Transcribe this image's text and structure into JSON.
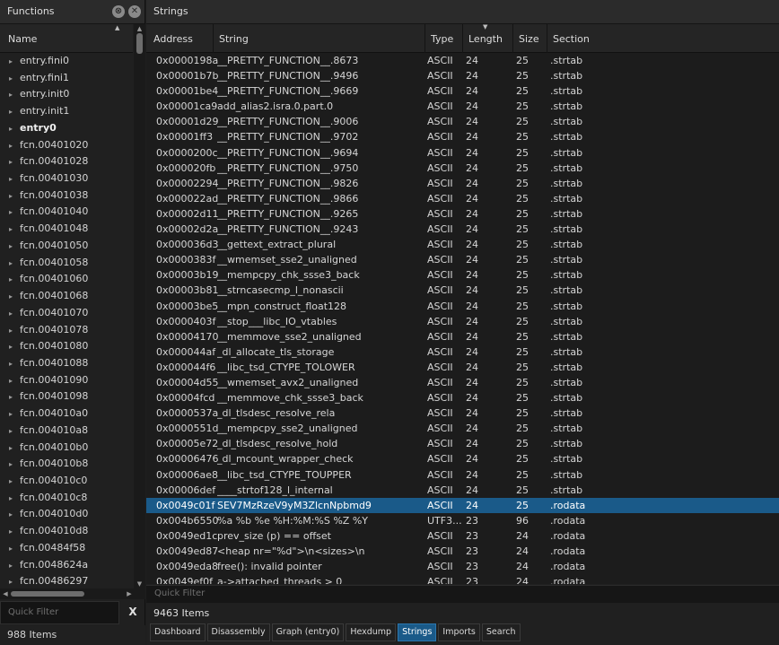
{
  "functions_pane": {
    "title": "Functions",
    "column_header": "Name",
    "items": [
      {
        "name": "entry.fini0",
        "bold": false
      },
      {
        "name": "entry.fini1",
        "bold": false
      },
      {
        "name": "entry.init0",
        "bold": false
      },
      {
        "name": "entry.init1",
        "bold": false
      },
      {
        "name": "entry0",
        "bold": true
      },
      {
        "name": "fcn.00401020",
        "bold": false
      },
      {
        "name": "fcn.00401028",
        "bold": false
      },
      {
        "name": "fcn.00401030",
        "bold": false
      },
      {
        "name": "fcn.00401038",
        "bold": false
      },
      {
        "name": "fcn.00401040",
        "bold": false
      },
      {
        "name": "fcn.00401048",
        "bold": false
      },
      {
        "name": "fcn.00401050",
        "bold": false
      },
      {
        "name": "fcn.00401058",
        "bold": false
      },
      {
        "name": "fcn.00401060",
        "bold": false
      },
      {
        "name": "fcn.00401068",
        "bold": false
      },
      {
        "name": "fcn.00401070",
        "bold": false
      },
      {
        "name": "fcn.00401078",
        "bold": false
      },
      {
        "name": "fcn.00401080",
        "bold": false
      },
      {
        "name": "fcn.00401088",
        "bold": false
      },
      {
        "name": "fcn.00401090",
        "bold": false
      },
      {
        "name": "fcn.00401098",
        "bold": false
      },
      {
        "name": "fcn.004010a0",
        "bold": false
      },
      {
        "name": "fcn.004010a8",
        "bold": false
      },
      {
        "name": "fcn.004010b0",
        "bold": false
      },
      {
        "name": "fcn.004010b8",
        "bold": false
      },
      {
        "name": "fcn.004010c0",
        "bold": false
      },
      {
        "name": "fcn.004010c8",
        "bold": false
      },
      {
        "name": "fcn.004010d0",
        "bold": false
      },
      {
        "name": "fcn.004010d8",
        "bold": false
      },
      {
        "name": "fcn.00484f58",
        "bold": false
      },
      {
        "name": "fcn.0048624a",
        "bold": false
      },
      {
        "name": "fcn.00486297",
        "bold": false
      }
    ],
    "filter_placeholder": "Quick Filter",
    "filter_clear": "X",
    "count_text": "988 Items"
  },
  "strings_pane": {
    "title": "Strings",
    "columns": {
      "address": "Address",
      "string": "String",
      "type": "Type",
      "length": "Length",
      "size": "Size",
      "section": "Section"
    },
    "rows": [
      {
        "address": "0x0000198a",
        "string": "__PRETTY_FUNCTION__.8673",
        "type": "ASCII",
        "length": "24",
        "size": "25",
        "section": ".strtab",
        "selected": false
      },
      {
        "address": "0x00001b7b",
        "string": "__PRETTY_FUNCTION__.9496",
        "type": "ASCII",
        "length": "24",
        "size": "25",
        "section": ".strtab",
        "selected": false
      },
      {
        "address": "0x00001be4",
        "string": "__PRETTY_FUNCTION__.9669",
        "type": "ASCII",
        "length": "24",
        "size": "25",
        "section": ".strtab",
        "selected": false
      },
      {
        "address": "0x00001ca9",
        "string": "add_alias2.isra.0.part.0",
        "type": "ASCII",
        "length": "24",
        "size": "25",
        "section": ".strtab",
        "selected": false
      },
      {
        "address": "0x00001d29",
        "string": "__PRETTY_FUNCTION__.9006",
        "type": "ASCII",
        "length": "24",
        "size": "25",
        "section": ".strtab",
        "selected": false
      },
      {
        "address": "0x00001ff3",
        "string": "__PRETTY_FUNCTION__.9702",
        "type": "ASCII",
        "length": "24",
        "size": "25",
        "section": ".strtab",
        "selected": false
      },
      {
        "address": "0x0000200c",
        "string": "__PRETTY_FUNCTION__.9694",
        "type": "ASCII",
        "length": "24",
        "size": "25",
        "section": ".strtab",
        "selected": false
      },
      {
        "address": "0x000020fb",
        "string": "__PRETTY_FUNCTION__.9750",
        "type": "ASCII",
        "length": "24",
        "size": "25",
        "section": ".strtab",
        "selected": false
      },
      {
        "address": "0x00002294",
        "string": "__PRETTY_FUNCTION__.9826",
        "type": "ASCII",
        "length": "24",
        "size": "25",
        "section": ".strtab",
        "selected": false
      },
      {
        "address": "0x000022ad",
        "string": "__PRETTY_FUNCTION__.9866",
        "type": "ASCII",
        "length": "24",
        "size": "25",
        "section": ".strtab",
        "selected": false
      },
      {
        "address": "0x00002d11",
        "string": "__PRETTY_FUNCTION__.9265",
        "type": "ASCII",
        "length": "24",
        "size": "25",
        "section": ".strtab",
        "selected": false
      },
      {
        "address": "0x00002d2a",
        "string": "__PRETTY_FUNCTION__.9243",
        "type": "ASCII",
        "length": "24",
        "size": "25",
        "section": ".strtab",
        "selected": false
      },
      {
        "address": "0x000036d3",
        "string": "__gettext_extract_plural",
        "type": "ASCII",
        "length": "24",
        "size": "25",
        "section": ".strtab",
        "selected": false
      },
      {
        "address": "0x0000383f",
        "string": "__wmemset_sse2_unaligned",
        "type": "ASCII",
        "length": "24",
        "size": "25",
        "section": ".strtab",
        "selected": false
      },
      {
        "address": "0x00003b19",
        "string": "__mempcpy_chk_ssse3_back",
        "type": "ASCII",
        "length": "24",
        "size": "25",
        "section": ".strtab",
        "selected": false
      },
      {
        "address": "0x00003b81",
        "string": "__strncasecmp_l_nonascii",
        "type": "ASCII",
        "length": "24",
        "size": "25",
        "section": ".strtab",
        "selected": false
      },
      {
        "address": "0x00003be5",
        "string": "__mpn_construct_float128",
        "type": "ASCII",
        "length": "24",
        "size": "25",
        "section": ".strtab",
        "selected": false
      },
      {
        "address": "0x0000403f",
        "string": "__stop___libc_IO_vtables",
        "type": "ASCII",
        "length": "24",
        "size": "25",
        "section": ".strtab",
        "selected": false
      },
      {
        "address": "0x00004170",
        "string": "__memmove_sse2_unaligned",
        "type": "ASCII",
        "length": "24",
        "size": "25",
        "section": ".strtab",
        "selected": false
      },
      {
        "address": "0x000044af",
        "string": "_dl_allocate_tls_storage",
        "type": "ASCII",
        "length": "24",
        "size": "25",
        "section": ".strtab",
        "selected": false
      },
      {
        "address": "0x000044f6",
        "string": "__libc_tsd_CTYPE_TOLOWER",
        "type": "ASCII",
        "length": "24",
        "size": "25",
        "section": ".strtab",
        "selected": false
      },
      {
        "address": "0x00004d55",
        "string": "__wmemset_avx2_unaligned",
        "type": "ASCII",
        "length": "24",
        "size": "25",
        "section": ".strtab",
        "selected": false
      },
      {
        "address": "0x00004fcd",
        "string": "__memmove_chk_ssse3_back",
        "type": "ASCII",
        "length": "24",
        "size": "25",
        "section": ".strtab",
        "selected": false
      },
      {
        "address": "0x0000537a",
        "string": "_dl_tlsdesc_resolve_rela",
        "type": "ASCII",
        "length": "24",
        "size": "25",
        "section": ".strtab",
        "selected": false
      },
      {
        "address": "0x0000551d",
        "string": "__mempcpy_sse2_unaligned",
        "type": "ASCII",
        "length": "24",
        "size": "25",
        "section": ".strtab",
        "selected": false
      },
      {
        "address": "0x00005e72",
        "string": "_dl_tlsdesc_resolve_hold",
        "type": "ASCII",
        "length": "24",
        "size": "25",
        "section": ".strtab",
        "selected": false
      },
      {
        "address": "0x00006476",
        "string": "_dl_mcount_wrapper_check",
        "type": "ASCII",
        "length": "24",
        "size": "25",
        "section": ".strtab",
        "selected": false
      },
      {
        "address": "0x00006ae8",
        "string": "__libc_tsd_CTYPE_TOUPPER",
        "type": "ASCII",
        "length": "24",
        "size": "25",
        "section": ".strtab",
        "selected": false
      },
      {
        "address": "0x00006def",
        "string": "____strtof128_l_internal",
        "type": "ASCII",
        "length": "24",
        "size": "25",
        "section": ".strtab",
        "selected": false
      },
      {
        "address": "0x0049c01f",
        "string": "SEV7MzRzeV9yM3ZlcnNpbmd9",
        "type": "ASCII",
        "length": "24",
        "size": "25",
        "section": ".rodata",
        "selected": true
      },
      {
        "address": "0x004b6550",
        "string": "%a %b %e %H:%M:%S %Z %Y",
        "type": "UTF3...",
        "length": "23",
        "size": "96",
        "section": ".rodata",
        "selected": false
      },
      {
        "address": "0x0049ed1c",
        "string": "prev_size (p) == offset",
        "type": "ASCII",
        "length": "23",
        "size": "24",
        "section": ".rodata",
        "selected": false
      },
      {
        "address": "0x0049ed87",
        "string": "<heap nr=\"%d\">\\n<sizes>\\n",
        "type": "ASCII",
        "length": "23",
        "size": "24",
        "section": ".rodata",
        "selected": false
      },
      {
        "address": "0x0049eda8",
        "string": "free(): invalid pointer",
        "type": "ASCII",
        "length": "23",
        "size": "24",
        "section": ".rodata",
        "selected": false
      },
      {
        "address": "0x0049ef0f",
        "string": "a->attached_threads > 0",
        "type": "ASCII",
        "length": "23",
        "size": "24",
        "section": ".rodata",
        "selected": false
      }
    ],
    "filter_placeholder": "Quick Filter",
    "count_text": "9463 Items"
  },
  "tabs": [
    {
      "label": "Dashboard",
      "active": false
    },
    {
      "label": "Disassembly",
      "active": false
    },
    {
      "label": "Graph (entry0)",
      "active": false
    },
    {
      "label": "Hexdump",
      "active": false
    },
    {
      "label": "Strings",
      "active": true
    },
    {
      "label": "Imports",
      "active": false
    },
    {
      "label": "Search",
      "active": false
    }
  ],
  "colors": {
    "selection": "#1a5a89",
    "background": "#1e1e1e"
  }
}
